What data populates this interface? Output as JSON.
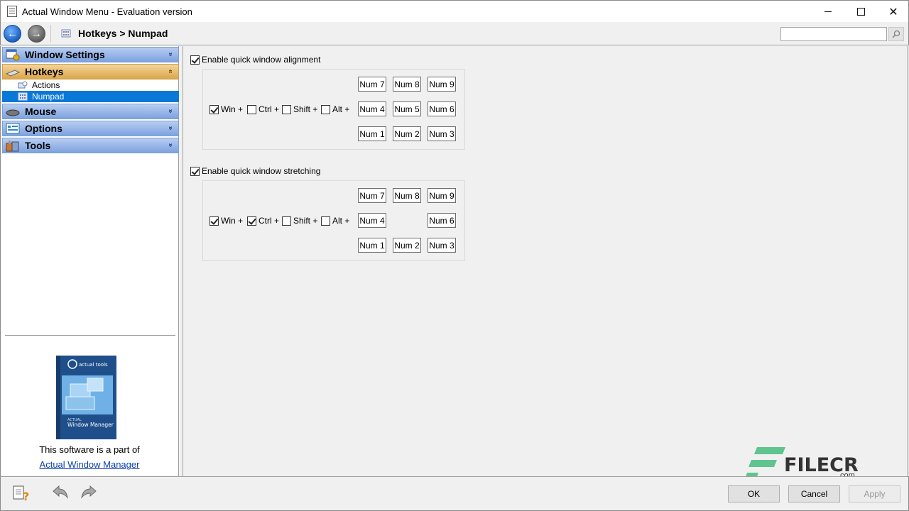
{
  "window": {
    "title": "Actual Window Menu - Evaluation version",
    "minimize_label": "",
    "close_label": "✕"
  },
  "navbar": {
    "back_glyph": "←",
    "forward_glyph": "→",
    "breadcrumb": "Hotkeys > Numpad",
    "search_value": "",
    "search_icon": "search-icon"
  },
  "sidebar": {
    "groups": [
      {
        "label": "Window Settings",
        "icon": "window-settings-icon",
        "expanded": false,
        "chevron": "»"
      },
      {
        "label": "Hotkeys",
        "icon": "keyboard-icon",
        "expanded": true,
        "chevron": "«"
      },
      {
        "label": "Mouse",
        "icon": "mouse-icon",
        "expanded": false,
        "chevron": "»"
      },
      {
        "label": "Options",
        "icon": "options-icon",
        "expanded": false,
        "chevron": "»"
      },
      {
        "label": "Tools",
        "icon": "tools-icon",
        "expanded": false,
        "chevron": "»"
      }
    ],
    "hotkeys_items": [
      {
        "label": "Actions",
        "icon": "actions-icon",
        "selected": false
      },
      {
        "label": "Numpad",
        "icon": "numpad-icon",
        "selected": true
      }
    ],
    "part_text": "This software is a part of",
    "part_link": "Actual Window Manager",
    "product_box_label_1": "ACTUAL",
    "product_box_label_2": "Window Manager",
    "product_box_brand": "actual tools"
  },
  "alignment": {
    "enable_label": "Enable quick window alignment",
    "enabled": true,
    "modifiers": [
      {
        "label": "Win +",
        "checked": true
      },
      {
        "label": "Ctrl +",
        "checked": false
      },
      {
        "label": "Shift +",
        "checked": false
      },
      {
        "label": "Alt +",
        "checked": false
      }
    ],
    "keys": [
      "Num 7",
      "Num 8",
      "Num 9",
      "Num 4",
      "Num 5",
      "Num 6",
      "Num 1",
      "Num 2",
      "Num 3"
    ]
  },
  "stretching": {
    "enable_label": "Enable quick window stretching",
    "enabled": true,
    "modifiers": [
      {
        "label": "Win +",
        "checked": true
      },
      {
        "label": "Ctrl +",
        "checked": true
      },
      {
        "label": "Shift +",
        "checked": false
      },
      {
        "label": "Alt +",
        "checked": false
      }
    ],
    "keys": [
      "Num 7",
      "Num 8",
      "Num 9",
      "Num 4",
      "Num 6",
      "Num 1",
      "Num 2",
      "Num 3"
    ]
  },
  "bottom": {
    "help_icon": "help-icon",
    "undo_icon": "undo-icon",
    "redo_icon": "redo-icon",
    "ok_label": "OK",
    "cancel_label": "Cancel",
    "apply_label": "Apply"
  },
  "watermark": {
    "text": "FILECR",
    "suffix": ".com"
  },
  "colors": {
    "selection": "#0a78d7",
    "group_header": "#7da2e0",
    "group_header_open": "#dca64a",
    "link": "#0b3fae"
  }
}
